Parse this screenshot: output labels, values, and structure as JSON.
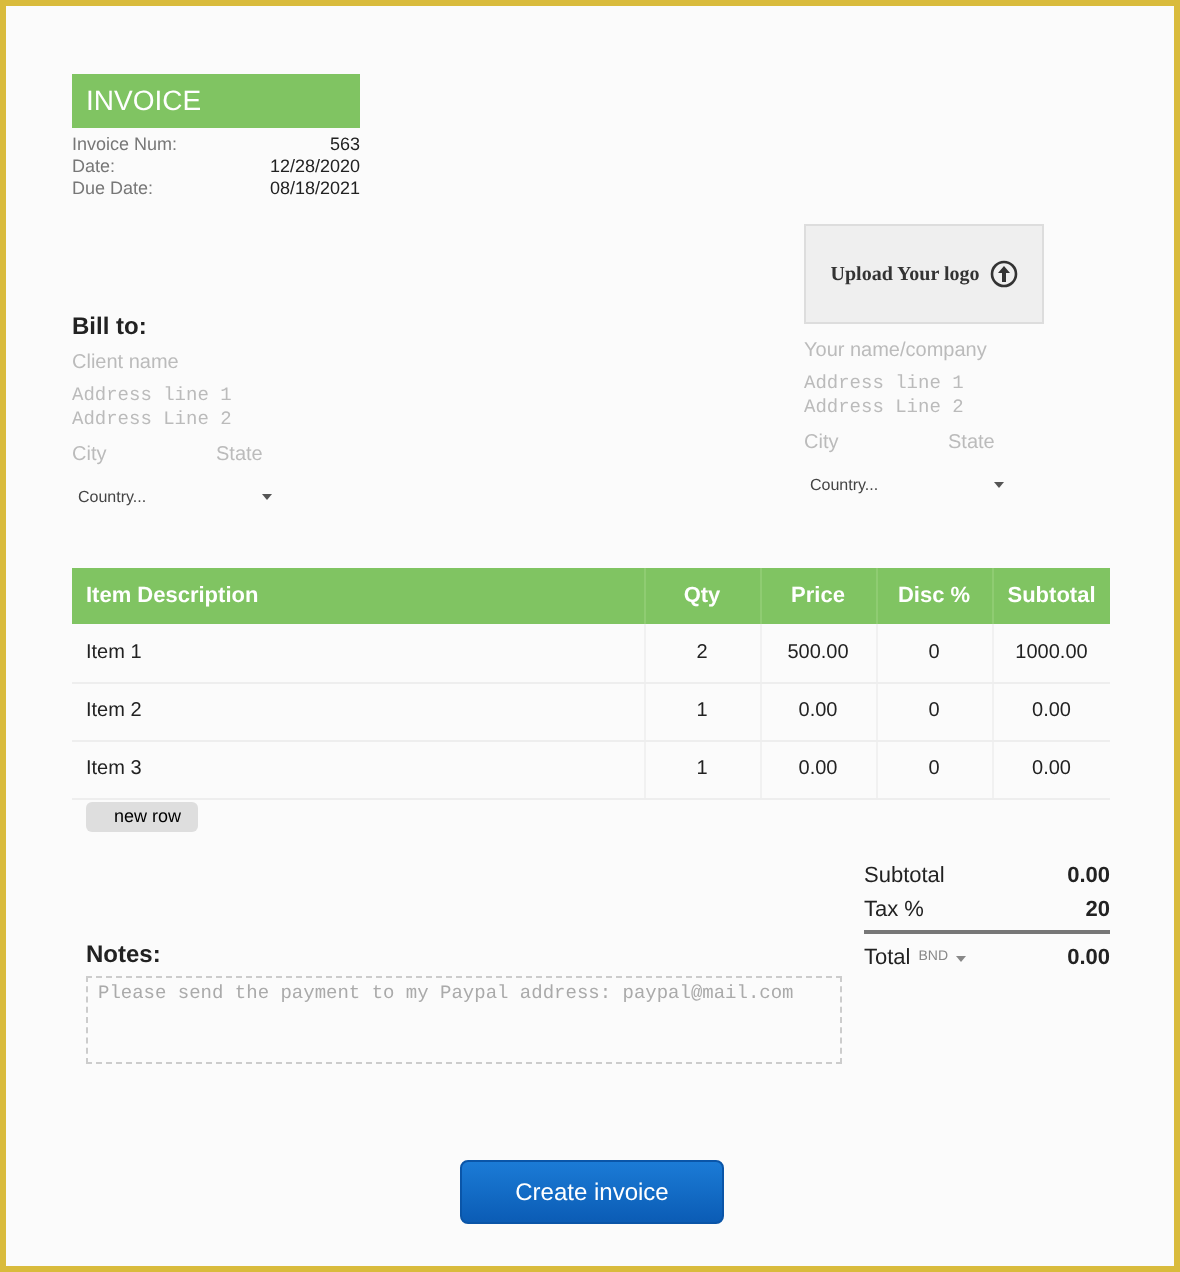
{
  "invoice": {
    "title": "INVOICE",
    "meta": [
      {
        "label": "Invoice Num:",
        "value": "563"
      },
      {
        "label": "Date:",
        "value": "12/28/2020"
      },
      {
        "label": "Due Date:",
        "value": "08/18/2021"
      }
    ]
  },
  "logo_upload": {
    "label": "Upload Your logo"
  },
  "bill_to": {
    "heading": "Bill to:",
    "name_placeholder": "Client name",
    "address_1_placeholder": "Address line 1",
    "address_2_placeholder": "Address Line 2",
    "city_placeholder": "City",
    "state_placeholder": "State",
    "country": "Country..."
  },
  "sender": {
    "name_placeholder": "Your name/company",
    "address_1_placeholder": "Address line 1",
    "address_2_placeholder": "Address Line 2",
    "city_placeholder": "City",
    "state_placeholder": "State",
    "country": "Country..."
  },
  "table": {
    "columns": [
      "Item Description",
      "Qty",
      "Price",
      "Disc %",
      "Subtotal"
    ],
    "rows": [
      [
        "Item 1",
        "2",
        "500.00",
        "0",
        "1000.00"
      ],
      [
        "Item 2",
        "1",
        "0.00",
        "0",
        "0.00"
      ],
      [
        "Item 3",
        "1",
        "0.00",
        "0",
        "0.00"
      ]
    ],
    "new_row_button": "new row"
  },
  "totals": {
    "subtotal_label": "Subtotal",
    "subtotal": "0.00",
    "tax_label": "Tax %",
    "tax": "20",
    "total_label": "Total",
    "currency": "BND",
    "total": "0.00"
  },
  "notes": {
    "heading": "Notes:",
    "placeholder": "Please send the payment to my Paypal address: paypal@mail.com"
  },
  "create_button": "Create invoice"
}
